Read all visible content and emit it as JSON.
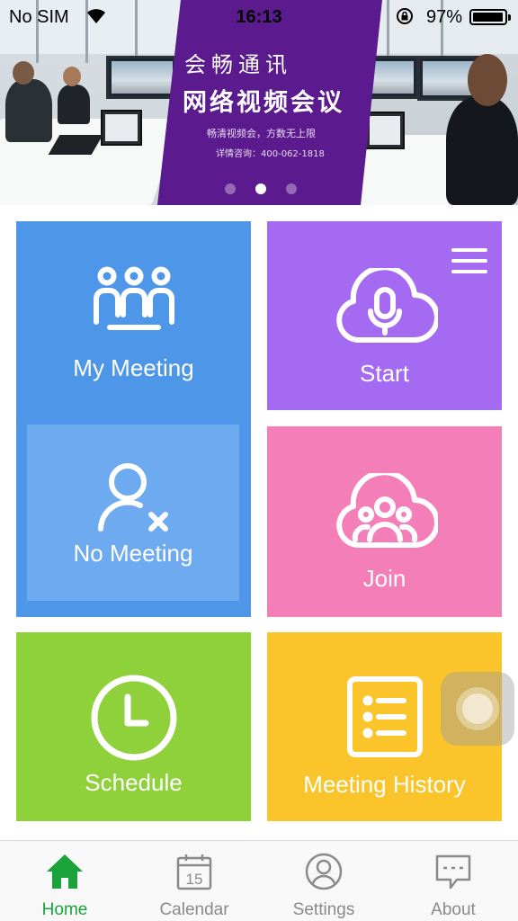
{
  "status_bar": {
    "carrier": "No SIM",
    "time": "16:13",
    "battery_percent": "97%",
    "battery_level": 0.97
  },
  "banner": {
    "title_line1": "会畅通讯",
    "title_line2": "网络视频会议",
    "subtitle": "畅清视频会，方数无上限",
    "contact": "详情咨询：400-062-1818",
    "page_count": 3,
    "active_page": 2,
    "promo_color": "#5b1a8e"
  },
  "tiles": {
    "my_meeting": {
      "label": "My Meeting",
      "icon": "group-icon",
      "color": "#4e96e8"
    },
    "no_meeting": {
      "label": "No Meeting",
      "icon": "user-remove-icon",
      "color": "#6eaaf0"
    },
    "start": {
      "label": "Start",
      "icon": "cloud-microphone-icon",
      "color": "#a46bf2"
    },
    "join": {
      "label": "Join",
      "icon": "cloud-people-icon",
      "color": "#f47eb8"
    },
    "schedule": {
      "label": "Schedule",
      "icon": "clock-icon",
      "color": "#8fd13a"
    },
    "history": {
      "label": "Meeting History",
      "icon": "list-icon",
      "color": "#fac42a"
    },
    "menu_icon": "hamburger-menu-icon"
  },
  "tab_bar": {
    "active_color": "#1aa33a",
    "inactive_color": "#8a8a8a",
    "items": [
      {
        "label": "Home",
        "icon": "home-icon",
        "active": true
      },
      {
        "label": "Calendar",
        "icon": "calendar-icon",
        "active": false,
        "calendar_day": "15"
      },
      {
        "label": "Settings",
        "icon": "user-circle-icon",
        "active": false
      },
      {
        "label": "About",
        "icon": "chat-bubble-icon",
        "active": false
      }
    ]
  }
}
